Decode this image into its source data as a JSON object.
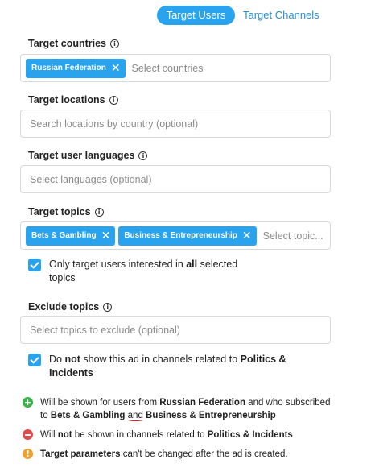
{
  "tabs": {
    "active": "Target Users",
    "inactive": "Target Channels"
  },
  "countries": {
    "label": "Target countries",
    "chip": "Russian Federation",
    "placeholder": "Select countries"
  },
  "locations": {
    "label": "Target locations",
    "placeholder": "Search locations by country (optional)"
  },
  "languages": {
    "label": "Target user languages",
    "placeholder": "Select languages (optional)"
  },
  "topics": {
    "label": "Target topics",
    "chips": [
      "Bets & Gambling",
      "Business & Entrepreneurship"
    ],
    "placeholder": "Select topic..."
  },
  "only_interested": {
    "checked": true,
    "text_before": "Only target users interested in ",
    "text_bold": "all",
    "text_after": " selected",
    "text_line2": "topics"
  },
  "exclude": {
    "label": "Exclude topics",
    "placeholder": "Select topics to exclude (optional)"
  },
  "no_show": {
    "checked": true,
    "text_before": "Do ",
    "text_bold1": "not",
    "text_mid": " show this ad in channels related to ",
    "text_bold2": "Politics &",
    "text_bold3": "Incidents"
  },
  "notes": {
    "shown": {
      "a": "Will be shown for users from ",
      "b": "Russian Federation",
      "c": " and who subscribed",
      "d": "to ",
      "e": "Bets & Gambling",
      "f": " ",
      "g": "and",
      "h": " ",
      "i": "Business & Entrepreneurship"
    },
    "not_shown": {
      "a": "Will ",
      "b": "not",
      "c": " be shown in channels related to ",
      "d": "Politics & Incidents"
    },
    "warning": {
      "a": "Target parameters",
      "b": " can't be changed after the ad is created."
    }
  },
  "icons": {
    "info": "info-icon",
    "close": "close-icon",
    "check": "checkmark-icon",
    "plus": "plus-circle-icon",
    "minus": "minus-circle-icon",
    "warning": "exclamation-circle-icon"
  },
  "colors": {
    "accent": "#2aa3ef",
    "link": "#2b8fd6",
    "green": "#3cb34a",
    "red": "#e04b4b",
    "orange": "#f0a030"
  }
}
